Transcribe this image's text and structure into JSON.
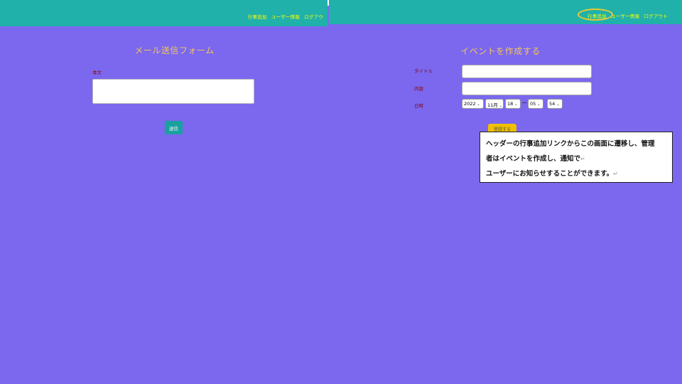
{
  "left": {
    "nav": [
      "行事追加",
      "ユーザー情報",
      "ログアウ"
    ],
    "title": "メール送信フォーム",
    "body_label": "本文",
    "send_button": "送信"
  },
  "right": {
    "nav": [
      "行事追加",
      "ユーザー情報",
      "ログアウト"
    ],
    "title": "イベントを作成する",
    "labels": {
      "title": "タイトル",
      "content": "内容",
      "datetime": "日時"
    },
    "datetime": {
      "year": "2022",
      "month": "11月",
      "day": "18",
      "hour": "05",
      "minute": "54",
      "separator": "—"
    },
    "register_button": "登録する",
    "callout": {
      "line1": "ヘッダーの行事追加リンクからこの画面に遷移し、管理",
      "line2": "者はイベントを作成し、通知で",
      "line3": "ユーザーにお知らせすることができます。",
      "return_mark": "↵"
    },
    "highlight_color": "#e8c832"
  },
  "colors": {
    "background": "#7b68ee",
    "header": "#20b2aa",
    "nav_text": "#ffff00",
    "title": "#f5c45a",
    "label": "#8b0000"
  }
}
